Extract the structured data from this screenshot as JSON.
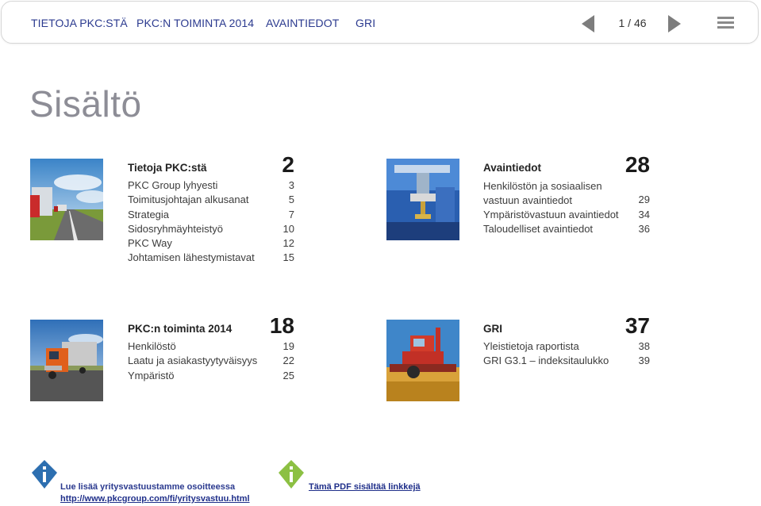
{
  "nav": {
    "items": [
      "TIETOJA PKC:STÄ",
      "PKC:N TOIMINTA 2014",
      "AVAINTIEDOT",
      "GRI"
    ],
    "page_indicator": "1 / 46"
  },
  "page_title": "Sisältö",
  "sections": [
    {
      "name": "Tietoja PKC:stä",
      "page": "2",
      "rows": [
        {
          "label": "PKC Group lyhyesti",
          "page": "3"
        },
        {
          "label": "Toimitusjohtajan alkusanat",
          "page": "5"
        },
        {
          "label": "Strategia",
          "page": "7"
        },
        {
          "label": "Sidosryhmäyhteistyö",
          "page": "10"
        },
        {
          "label": "PKC Way",
          "page": "12"
        },
        {
          "label": "Johtamisen lähestymistavat",
          "page": "15"
        }
      ]
    },
    {
      "name": "Avaintiedot",
      "page": "28",
      "rows": [
        {
          "label": "Henkilöstön ja sosiaalisen vastuun avaintiedot",
          "page": "29"
        },
        {
          "label": "Ympäristövastuun avaintiedot",
          "page": "34"
        },
        {
          "label": "Taloudelliset avaintiedot",
          "page": "36"
        }
      ]
    },
    {
      "name": "PKC:n toiminta 2014",
      "page": "18",
      "rows": [
        {
          "label": "Henkilöstö",
          "page": "19"
        },
        {
          "label": "Laatu ja asiakastyytyväisyys",
          "page": "22"
        },
        {
          "label": "Ympäristö",
          "page": "25"
        }
      ]
    },
    {
      "name": "GRI",
      "page": "37",
      "rows": [
        {
          "label": "Yleistietoja raportista",
          "page": "38"
        },
        {
          "label": "GRI G3.1 – indeksitaulukko",
          "page": "39"
        }
      ]
    }
  ],
  "footer": {
    "info_text": "Lue lisää yritysvastuustamme osoitteessa",
    "info_link": "http://www.pkcgroup.com/fi/yritysvastuu.html",
    "pdf_note": "Tämä PDF sisältää linkkejä"
  },
  "colors": {
    "nav_text": "#2b3a8f",
    "title": "#8d8d96",
    "info_blue": "#2d6fb0",
    "info_green": "#8cc043"
  },
  "icons": [
    "previous-page-icon",
    "next-page-icon",
    "menu-icon",
    "info-icon-blue",
    "info-icon-green"
  ]
}
